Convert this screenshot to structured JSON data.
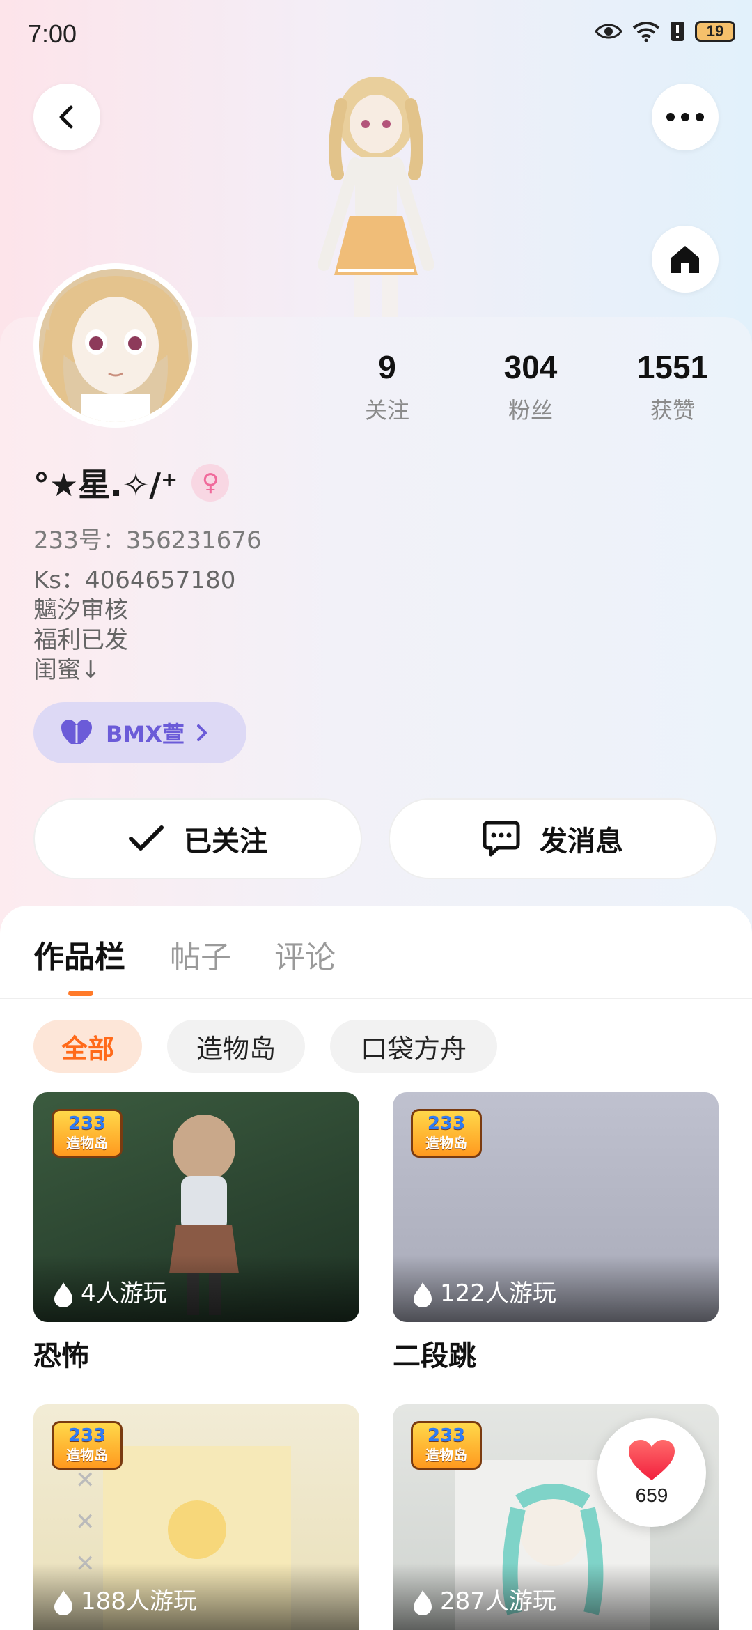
{
  "status_bar": {
    "time": "7:00",
    "battery": "19"
  },
  "profile": {
    "nickname": "°★星.✧/⁺",
    "uid": "233号：356231676",
    "bio_lines": [
      "Ks：4064657180",
      "魑汐审核",
      "福利已发",
      "闺蜜↓"
    ],
    "tag_label": "BMX萱",
    "stats": [
      {
        "value": "9",
        "label": "关注"
      },
      {
        "value": "304",
        "label": "粉丝"
      },
      {
        "value": "1551",
        "label": "获赞"
      }
    ]
  },
  "actions": {
    "follow_label": "已关注",
    "message_label": "发消息"
  },
  "tabs": [
    {
      "label": "作品栏",
      "active": true
    },
    {
      "label": "帖子",
      "active": false
    },
    {
      "label": "评论",
      "active": false
    }
  ],
  "filters": [
    {
      "label": "全部",
      "active": true
    },
    {
      "label": "造物岛",
      "active": false
    },
    {
      "label": "口袋方舟",
      "active": false
    }
  ],
  "works": [
    {
      "badge_top": "233",
      "badge_bottom": "造物岛",
      "plays": "4人游玩",
      "title": "恐怖"
    },
    {
      "badge_top": "233",
      "badge_bottom": "造物岛",
      "plays": "122人游玩",
      "title": "二段跳"
    },
    {
      "badge_top": "233",
      "badge_bottom": "造物岛",
      "plays": "188人游玩",
      "title": ""
    },
    {
      "badge_top": "233",
      "badge_bottom": "造物岛",
      "plays": "287人游玩",
      "title": ""
    }
  ],
  "like_float": {
    "count": "659"
  },
  "colors": {
    "accent": "#ff7a2a",
    "tag": "#6b5bd8",
    "like": "#ff3b3b"
  }
}
